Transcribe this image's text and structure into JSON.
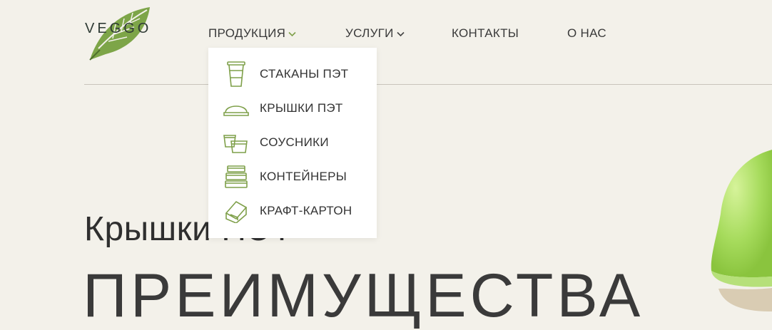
{
  "brand": {
    "logo_text": "VEGGO"
  },
  "nav": {
    "items": [
      {
        "label": "ПРОДУКЦИЯ",
        "has_dropdown": true,
        "active": true
      },
      {
        "label": "УСЛУГИ",
        "has_dropdown": true,
        "active": false
      },
      {
        "label": "КОНТАКТЫ",
        "has_dropdown": false,
        "active": false
      },
      {
        "label": "О НАС",
        "has_dropdown": false,
        "active": false
      }
    ]
  },
  "dropdown": {
    "items": [
      {
        "label": "СТАКАНЫ ПЭТ",
        "icon": "cup-icon"
      },
      {
        "label": "КРЫШКИ ПЭТ",
        "icon": "dome-lid-icon"
      },
      {
        "label": "СОУСНИКИ",
        "icon": "sauce-cup-icon"
      },
      {
        "label": "КОНТЕЙНЕРЫ",
        "icon": "container-stack-icon"
      },
      {
        "label": "КРАФТ-КАРТОН",
        "icon": "kraft-box-icon"
      }
    ]
  },
  "hero": {
    "subtitle": "Крышки ПЭТ",
    "headline": "ПРЕИМУЩЕСТВА"
  },
  "colors": {
    "background": "#f3f1ea",
    "accent_green": "#7fa04a",
    "text": "#3a3a3a",
    "dropdown_bg": "#ffffff"
  }
}
